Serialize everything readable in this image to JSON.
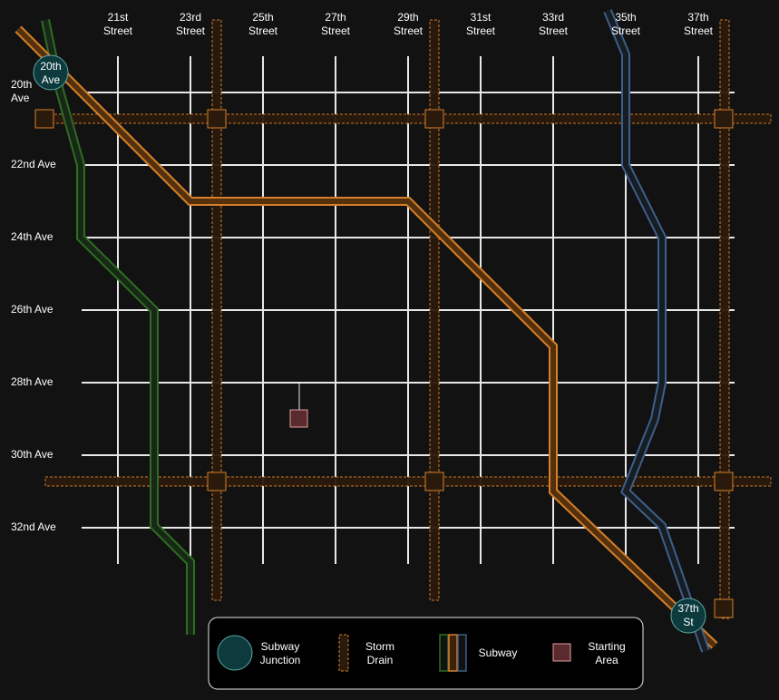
{
  "streets": [
    {
      "line1": "21st",
      "line2": "Street"
    },
    {
      "line1": "23rd",
      "line2": "Street"
    },
    {
      "line1": "25th",
      "line2": "Street"
    },
    {
      "line1": "27th",
      "line2": "Street"
    },
    {
      "line1": "29th",
      "line2": "Street"
    },
    {
      "line1": "31st",
      "line2": "Street"
    },
    {
      "line1": "33rd",
      "line2": "Street"
    },
    {
      "line1": "35th",
      "line2": "Street"
    },
    {
      "line1": "37th",
      "line2": "Street"
    }
  ],
  "avenues": [
    {
      "line1": "20th",
      "line2": "Ave"
    },
    {
      "line1": "22nd Ave",
      "line2": ""
    },
    {
      "line1": "24th Ave",
      "line2": ""
    },
    {
      "line1": "26th Ave",
      "line2": ""
    },
    {
      "line1": "28th Ave",
      "line2": ""
    },
    {
      "line1": "30th Ave",
      "line2": ""
    },
    {
      "line1": "32nd Ave",
      "line2": ""
    }
  ],
  "junctions": [
    {
      "line1": "20th",
      "line2": "Ave"
    },
    {
      "line1": "37th",
      "line2": "St"
    }
  ],
  "legend": {
    "junction": {
      "line1": "Subway",
      "line2": "Junction"
    },
    "drain": {
      "line1": "Storm",
      "line2": "Drain"
    },
    "subway": {
      "line1": "Subway"
    },
    "start": {
      "line1": "Starting",
      "line2": "Area"
    }
  },
  "colors": {
    "background": "#121212",
    "grid": "#e8e8e8",
    "drain": "#d4802a",
    "drain_fill": "#2a1a0c",
    "green_line": "#2f6b24",
    "orange_line": "#d4802a",
    "blue_line": "#3d5f8a",
    "junction_fill": "#0c3a3d",
    "junction_stroke": "#5fa6a6",
    "start_fill": "#5a2a2e",
    "start_stroke": "#e0a0a0"
  }
}
